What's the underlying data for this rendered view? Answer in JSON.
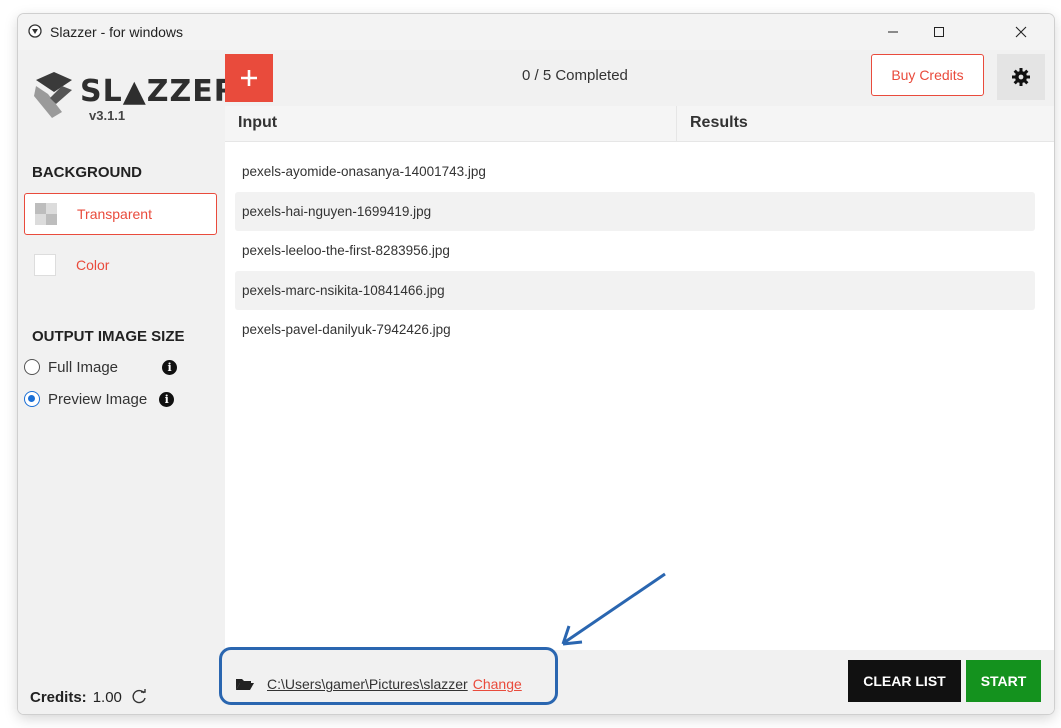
{
  "window": {
    "title": "Slazzer - for windows"
  },
  "sidebar": {
    "logo_text": "SL▲ZZER",
    "version": "v3.1.1",
    "background_title": "BACKGROUND",
    "background_options": [
      {
        "label": "Transparent",
        "selected": true
      },
      {
        "label": "Color",
        "selected": false
      }
    ],
    "output_title": "OUTPUT IMAGE SIZE",
    "output_options": [
      {
        "label": "Full Image",
        "selected": false
      },
      {
        "label": "Preview Image",
        "selected": true
      }
    ],
    "info_glyph": "i",
    "credits_label": "Credits:",
    "credits_value": "1.00"
  },
  "toolbar": {
    "add_glyph": "+",
    "progress": "0 / 5 Completed",
    "buy_credits": "Buy Credits"
  },
  "table": {
    "columns": [
      "Input",
      "Results"
    ],
    "rows": [
      "pexels-ayomide-onasanya-14001743.jpg",
      "pexels-hai-nguyen-1699419.jpg",
      "pexels-leeloo-the-first-8283956.jpg",
      "pexels-marc-nsikita-10841466.jpg",
      "pexels-pavel-danilyuk-7942426.jpg"
    ]
  },
  "footer": {
    "output_path": "C:\\Users\\gamer\\Pictures\\slazzer",
    "change_label": "Change",
    "clear_list": "CLEAR LIST",
    "start": "START"
  },
  "colors": {
    "accent": "#e94b3c",
    "start_green": "#14921e",
    "annotation_blue": "#2a66b0"
  }
}
